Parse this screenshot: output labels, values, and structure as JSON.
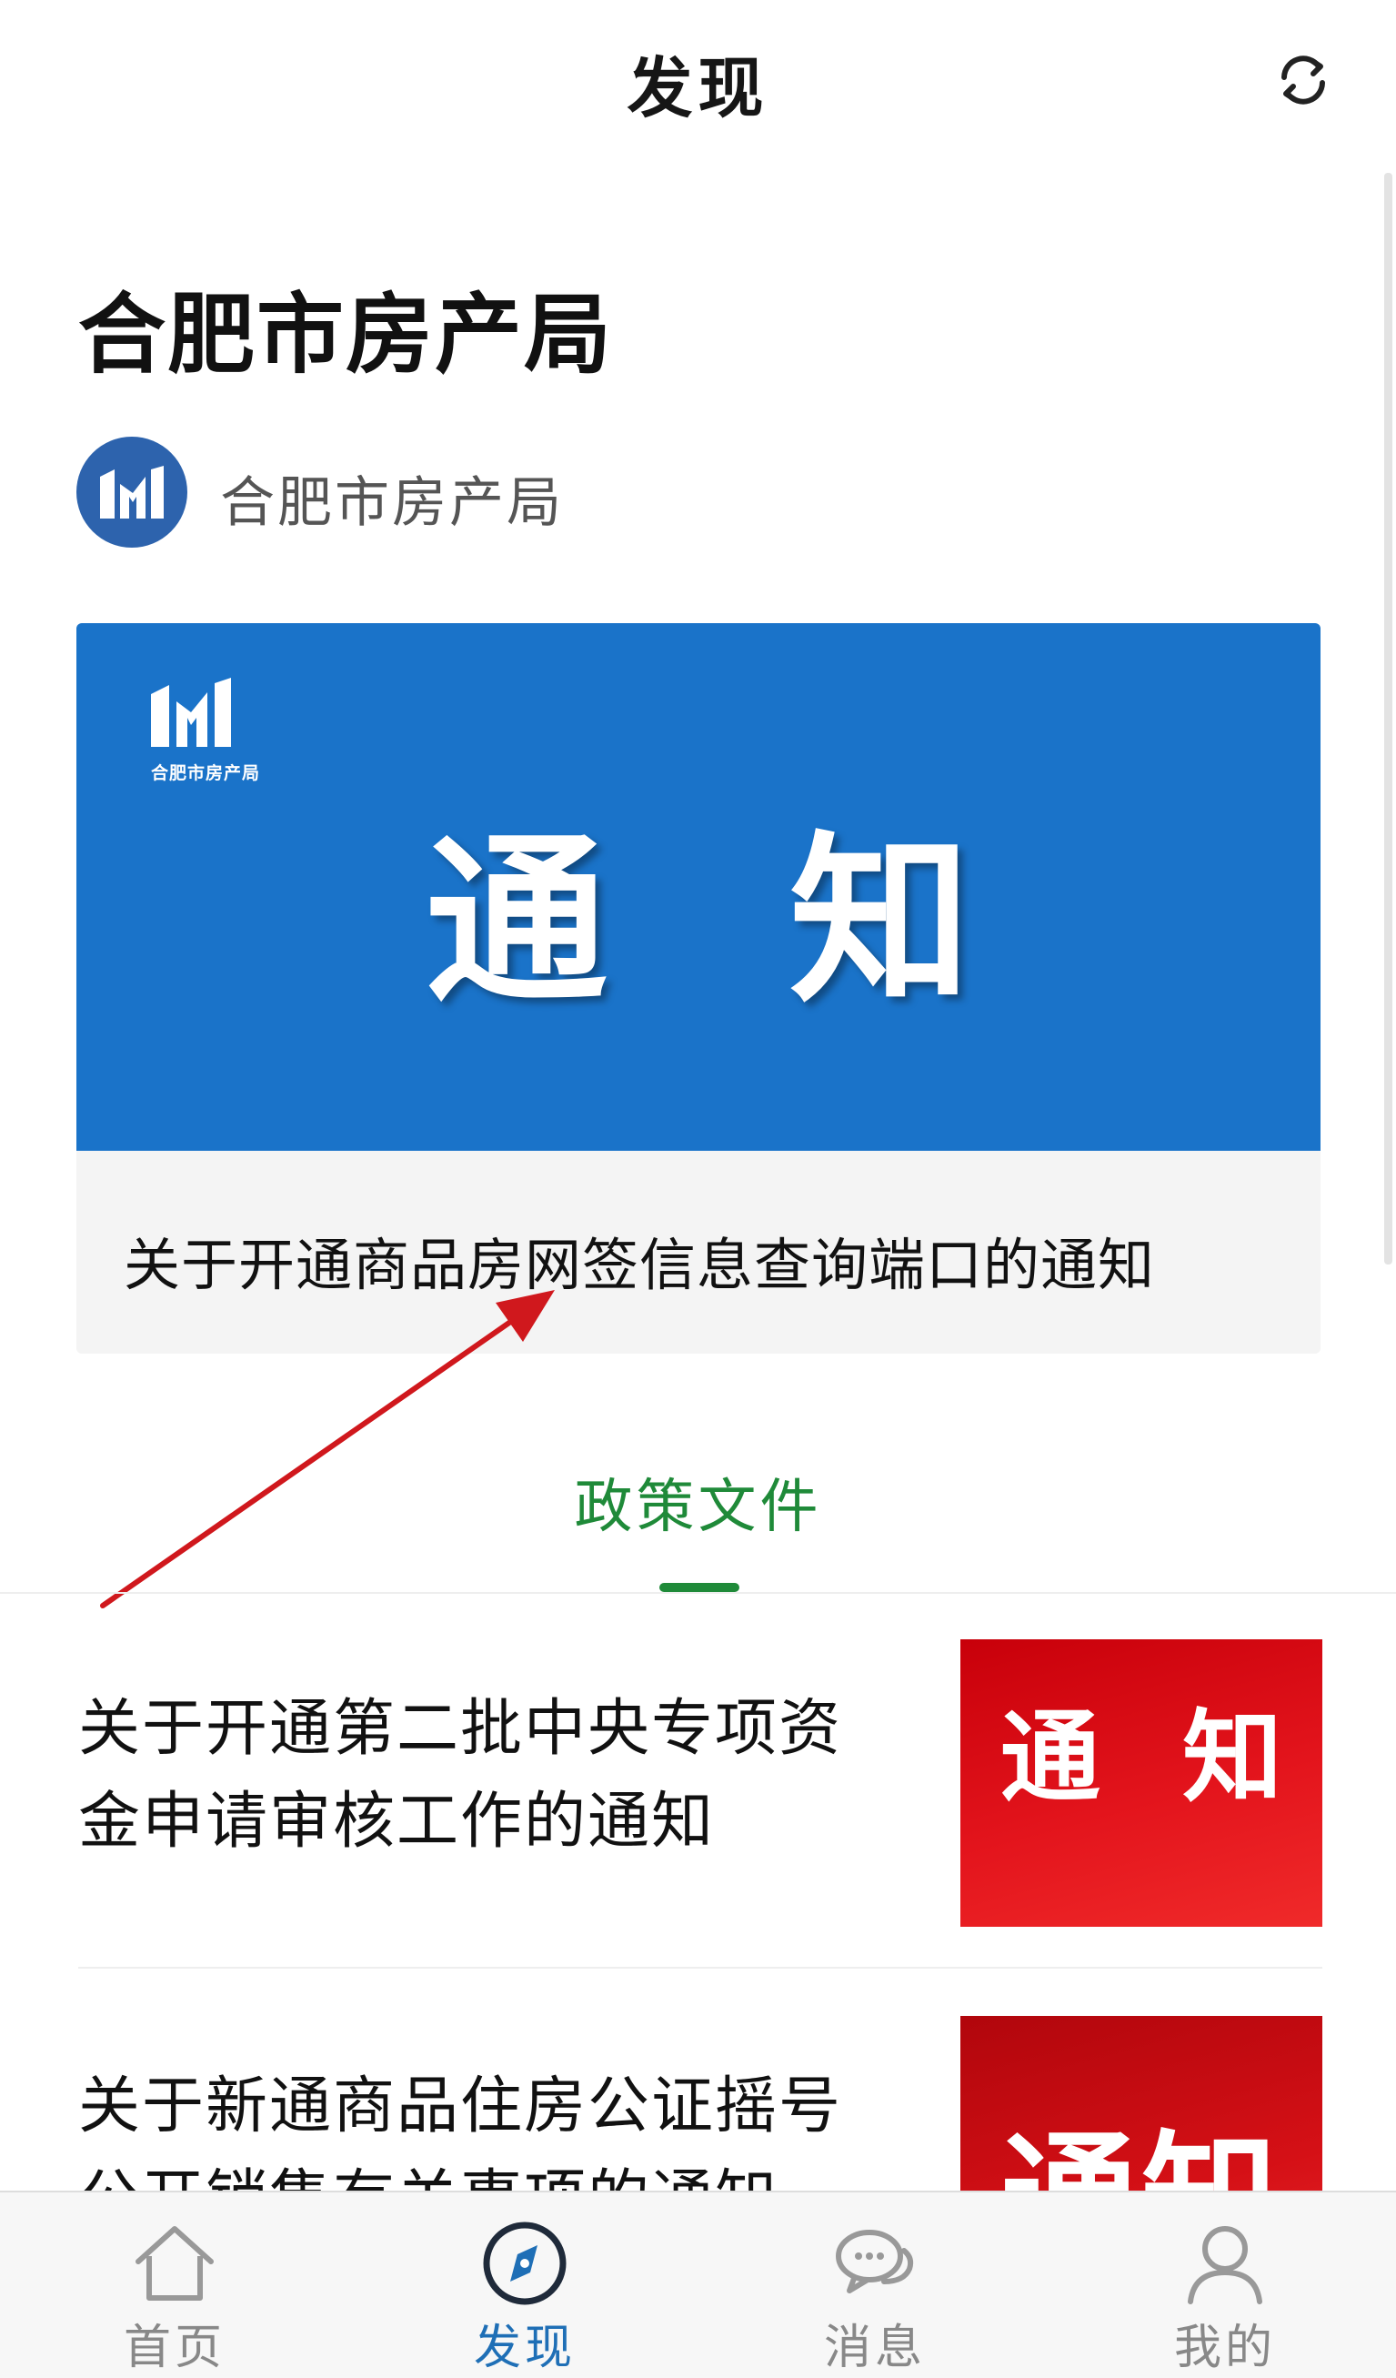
{
  "header": {
    "title": "发现",
    "refresh_icon": "refresh-icon"
  },
  "section": {
    "title": "合肥市房产局"
  },
  "source": {
    "name": "合肥市房产局",
    "avatar_icon": "housing-bureau-logo"
  },
  "featured": {
    "banner_logo_text": "合肥市房产局",
    "banner_text": "通知",
    "banner_color": "#1a73c9",
    "caption": "关于开通商品房网签信息查询端口的通知"
  },
  "tab": {
    "label": "政策文件",
    "accent": "#1f8a39"
  },
  "articles": [
    {
      "title": "关于开通第二批中央专项资金申请审核工作的通知",
      "thumb_text": "通 知"
    },
    {
      "title": "关于新通商品住房公证摇号公开销售有关事项的通知",
      "thumb_text": "通知"
    }
  ],
  "annotation": {
    "arrow_color": "#d0181d",
    "arrow_icon": "red-arrow-annotation"
  },
  "nav": [
    {
      "label": "首页",
      "icon": "home-icon",
      "active": false
    },
    {
      "label": "发现",
      "icon": "compass-icon",
      "active": true
    },
    {
      "label": "消息",
      "icon": "chat-icon",
      "active": false
    },
    {
      "label": "我的",
      "icon": "user-icon",
      "active": false
    }
  ]
}
